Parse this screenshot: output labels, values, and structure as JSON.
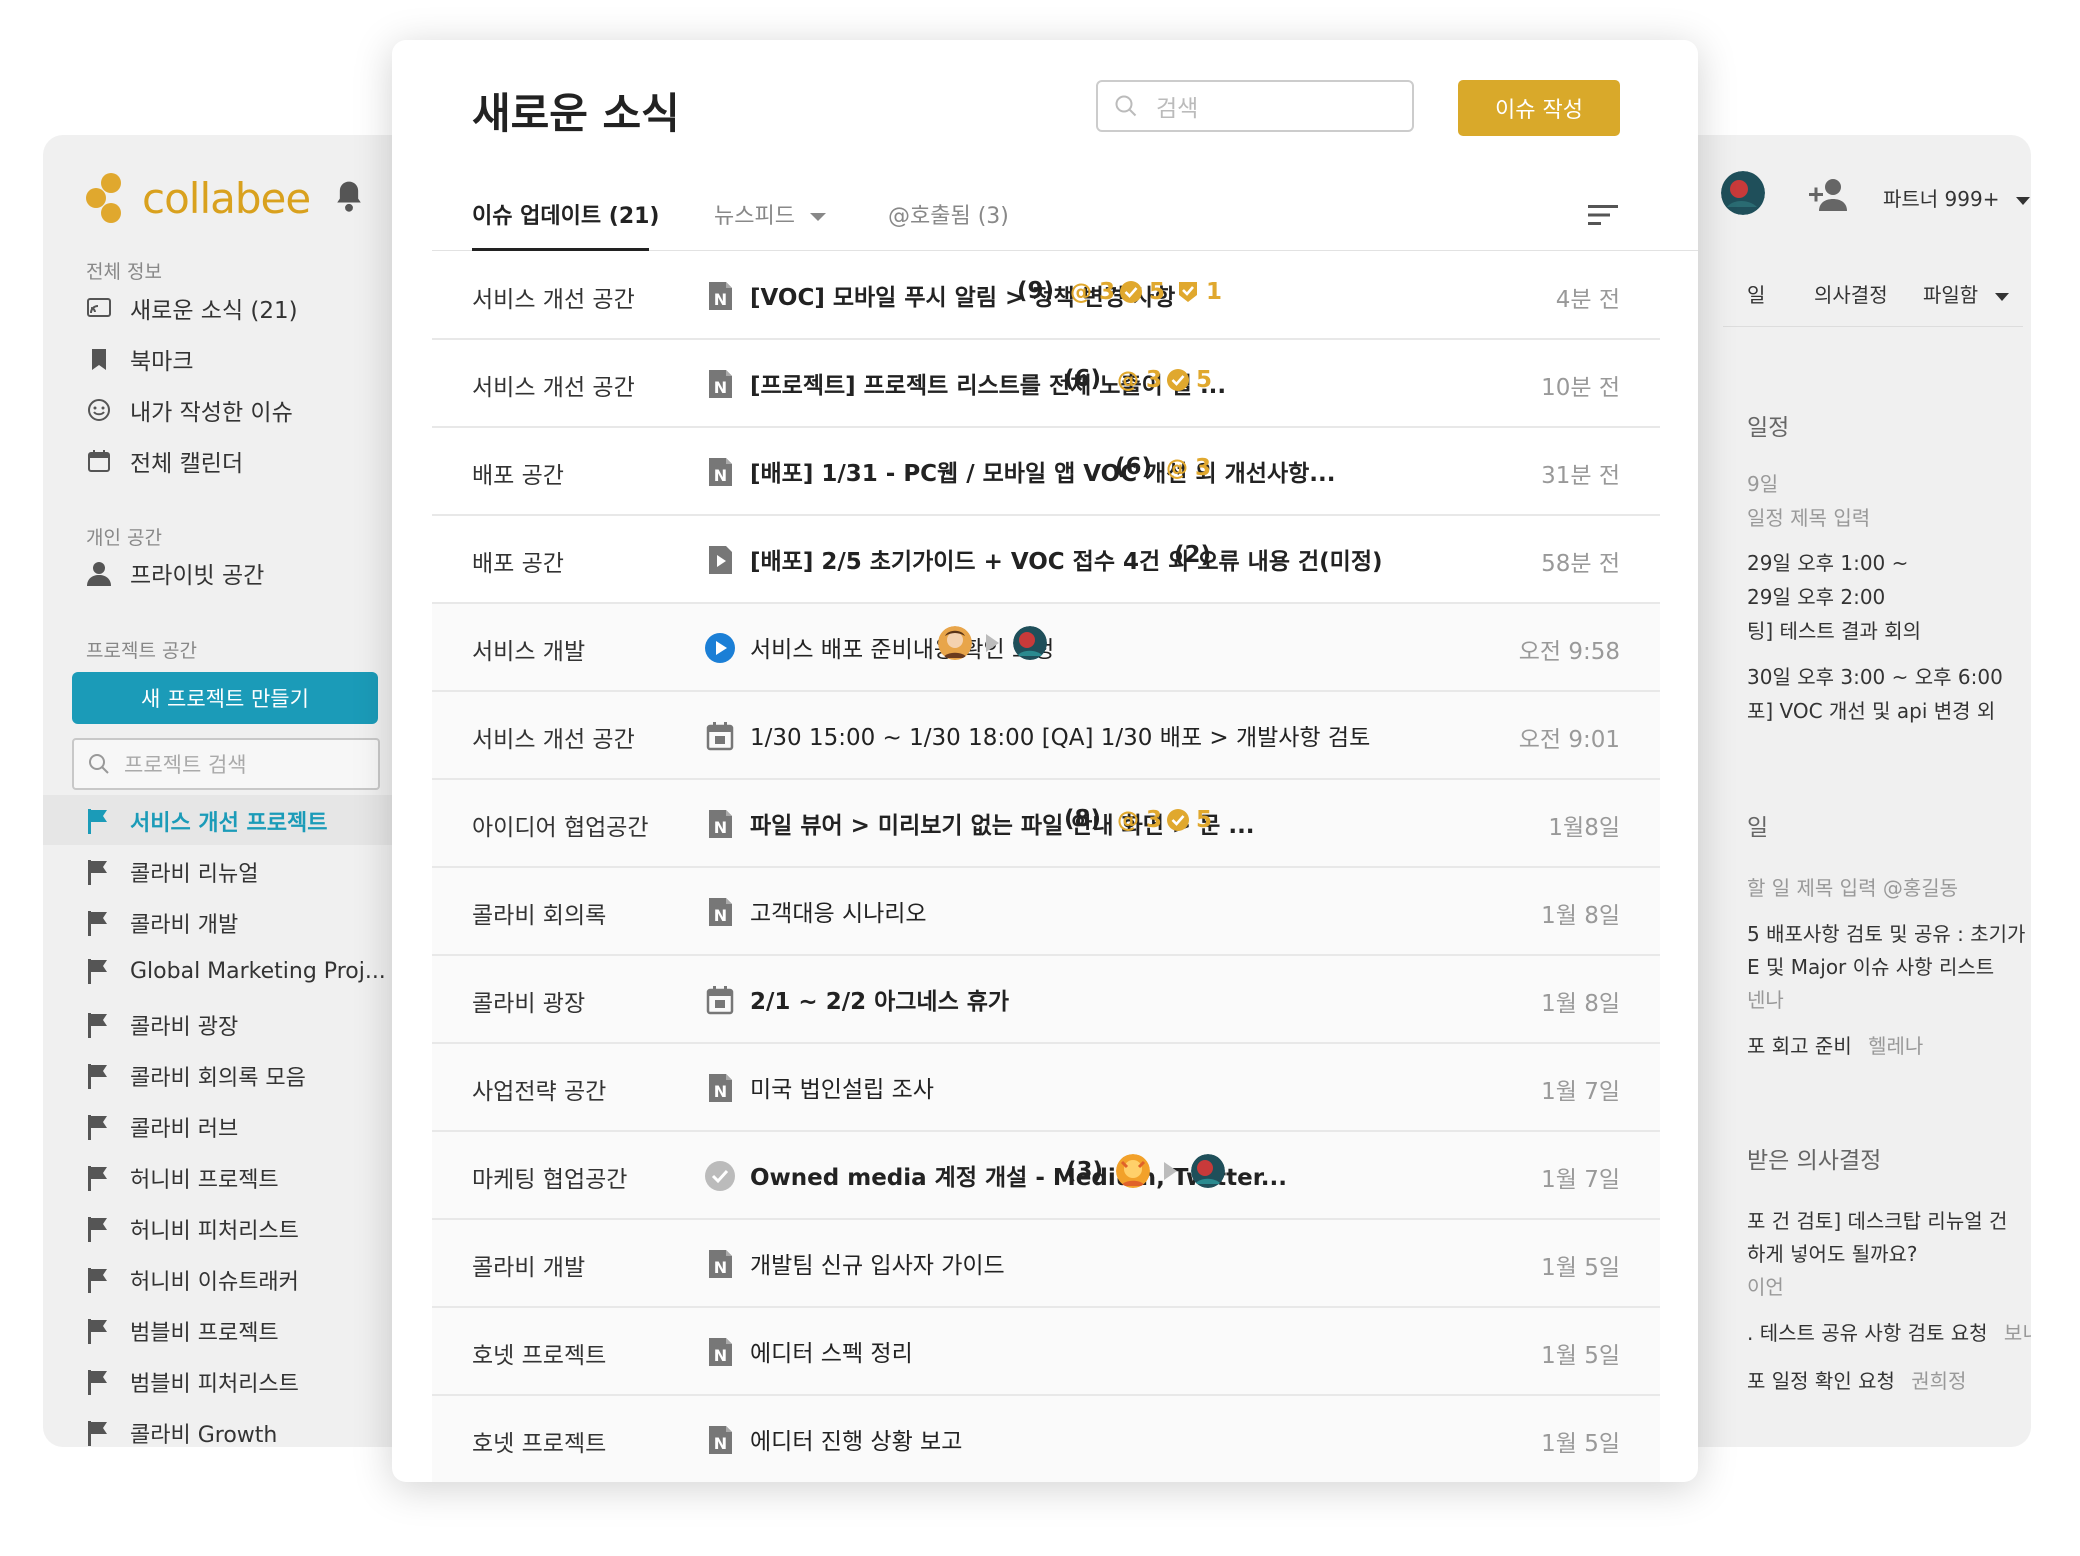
{
  "app": {
    "logo_text": "collabee",
    "sidebar": {
      "section_all": "전체 정보",
      "items_all": [
        {
          "label": "새로운 소식 (21)",
          "icon": "feed-icon"
        },
        {
          "label": "북마크",
          "icon": "bookmark-icon"
        },
        {
          "label": "내가 작성한 이슈",
          "icon": "smile-icon"
        },
        {
          "label": "전체 캘린더",
          "icon": "calendar-icon"
        }
      ],
      "section_personal": "개인 공간",
      "items_personal": [
        {
          "label": "프라이빗 공간",
          "icon": "person-icon"
        }
      ],
      "section_project": "프로젝트 공간",
      "new_project_label": "새 프로젝트 만들기",
      "project_search_placeholder": "프로젝트 검색",
      "projects": [
        {
          "label": "서비스 개선 프로젝트",
          "active": true
        },
        {
          "label": "콜라비 리뉴얼"
        },
        {
          "label": "콜라비 개발"
        },
        {
          "label": "Global Marketing Proj..."
        },
        {
          "label": "콜라비 광장"
        },
        {
          "label": "콜라비 회의록 모음"
        },
        {
          "label": "콜라비 러브"
        },
        {
          "label": "허니비 프로젝트"
        },
        {
          "label": "허니비 피처리스트"
        },
        {
          "label": "허니비 이슈트래커"
        },
        {
          "label": "범블비 프로젝트"
        },
        {
          "label": "범블비 피처리스트"
        },
        {
          "label": "콜라비 Growth"
        }
      ]
    },
    "right": {
      "partner_label": "파트너 999+",
      "tabs": [
        "일",
        "의사결정",
        "파일함"
      ],
      "schedule_heading": "일정",
      "schedule_date": "9일",
      "schedule_placeholder": "일정 제목 입력",
      "schedule_lines": [
        "29일 오후 1:00 ~",
        "29일 오후 2:00",
        "팅] 테스트 결과 회의",
        "30일 오후 3:00 ~ 오후 6:00",
        "포] VOC 개선 및 api 변경 외"
      ],
      "todo_heading": "일",
      "todo_placeholder": "할 일 제목 입력 @홍길동",
      "todo_lines": [
        "5 배포사항 검토 및 공유 : 초기가",
        "E 및 Major 이슈 사항 리스트",
        "넨나"
      ],
      "todo_retro": "포 회고 준비",
      "todo_retro_person": "헬레나",
      "decision_heading": "받은 의사결정",
      "decision_lines": [
        "포 건 검토] 데스크탑 리뉴얼 건",
        "하게 넣어도 될까요?",
        "이언"
      ],
      "decision_item2": ". 테스트 공유 사항 검토 요청",
      "decision_item2_person": "보니",
      "decision_item3": "포 일정 확인 요청",
      "decision_item3_person": "권희정"
    }
  },
  "panel": {
    "title": "새로운 소식",
    "search_placeholder": "검색",
    "create_label": "이슈 작성",
    "tabs": [
      "이슈 업데이트 (21)",
      "뉴스피드",
      "@호출됨 (3)"
    ],
    "rows": [
      {
        "space": "서비스 개선 공간",
        "icon": "note",
        "title": "[VOC] 모바일 푸시 알림 > 정책 변경 사항",
        "bold": true,
        "count": "(9)",
        "mention": "3",
        "check": "5",
        "shield": "1",
        "time": "4분 전"
      },
      {
        "space": "서비스 개선 공간",
        "icon": "note",
        "title": "[프로젝트] 프로젝트 리스트를 전체 노출이 필 ...",
        "bold": true,
        "count": "(6)",
        "mention": "3",
        "check": "5",
        "time": "10분 전"
      },
      {
        "space": "배포 공간",
        "icon": "note",
        "title": "[배포] 1/31 - PC웹 / 모바일 앱 VOC 개선 외 개선사항...",
        "bold": true,
        "count": "(6)",
        "mention": "3",
        "time": "31분 전"
      },
      {
        "space": "배포 공간",
        "icon": "play-doc",
        "title": "[배포] 2/5 초기가이드 + VOC 접수 4건 외 오류 내용 건(미정)",
        "bold": true,
        "count": "(2)",
        "time": "58분 전"
      },
      {
        "space": "서비스 개발",
        "icon": "play-circle",
        "title": "서비스 배포 준비내용 확인 요청",
        "bold": false,
        "flow": true,
        "time": "오전 9:58"
      },
      {
        "space": "서비스 개선 공간",
        "icon": "calendar",
        "title": "1/30 15:00 ~ 1/30 18:00 [QA] 1/30 배포 > 개발사항 검토",
        "bold": false,
        "time": "오전 9:01"
      },
      {
        "space": "아이디어 협업공간",
        "icon": "note",
        "title": "파일 뷰어 > 미리보기 없는 파일 안내 화면 > 문 ...",
        "bold": true,
        "count": "(8)",
        "mention": "3",
        "check": "5",
        "time": "1월8일"
      },
      {
        "space": "콜라비 회의록",
        "icon": "note",
        "title": "고객대응 시나리오",
        "bold": false,
        "time": "1월 8일"
      },
      {
        "space": "콜라비 광장",
        "icon": "calendar",
        "title": "2/1 ~ 2/2   아그네스 휴가",
        "bold": true,
        "time": "1월 8일"
      },
      {
        "space": "사업전략 공간",
        "icon": "note",
        "title": "미국 법인설립 조사",
        "bold": false,
        "time": "1월 7일"
      },
      {
        "space": "마케팅 협업공간",
        "icon": "check-circle",
        "title": "Owned media 계정 개설 - Medium, Twitter...",
        "bold": true,
        "count": "(3)",
        "flow": true,
        "time": "1월 7일"
      },
      {
        "space": "콜라비 개발",
        "icon": "note",
        "title": "개발팀 신규 입사자 가이드",
        "bold": false,
        "time": "1월 5일"
      },
      {
        "space": "호넷 프로젝트",
        "icon": "note",
        "title": "에디터 스펙 정리",
        "bold": false,
        "time": "1월 5일"
      },
      {
        "space": "호넷 프로젝트",
        "icon": "note",
        "title": "에디터 진행 상황 보고",
        "bold": false,
        "time": "1월 5일"
      }
    ]
  },
  "colors": {
    "brand_gold": "#d9a92a",
    "teal": "#1b9bb8",
    "badge_gold": "#e0a82e"
  }
}
